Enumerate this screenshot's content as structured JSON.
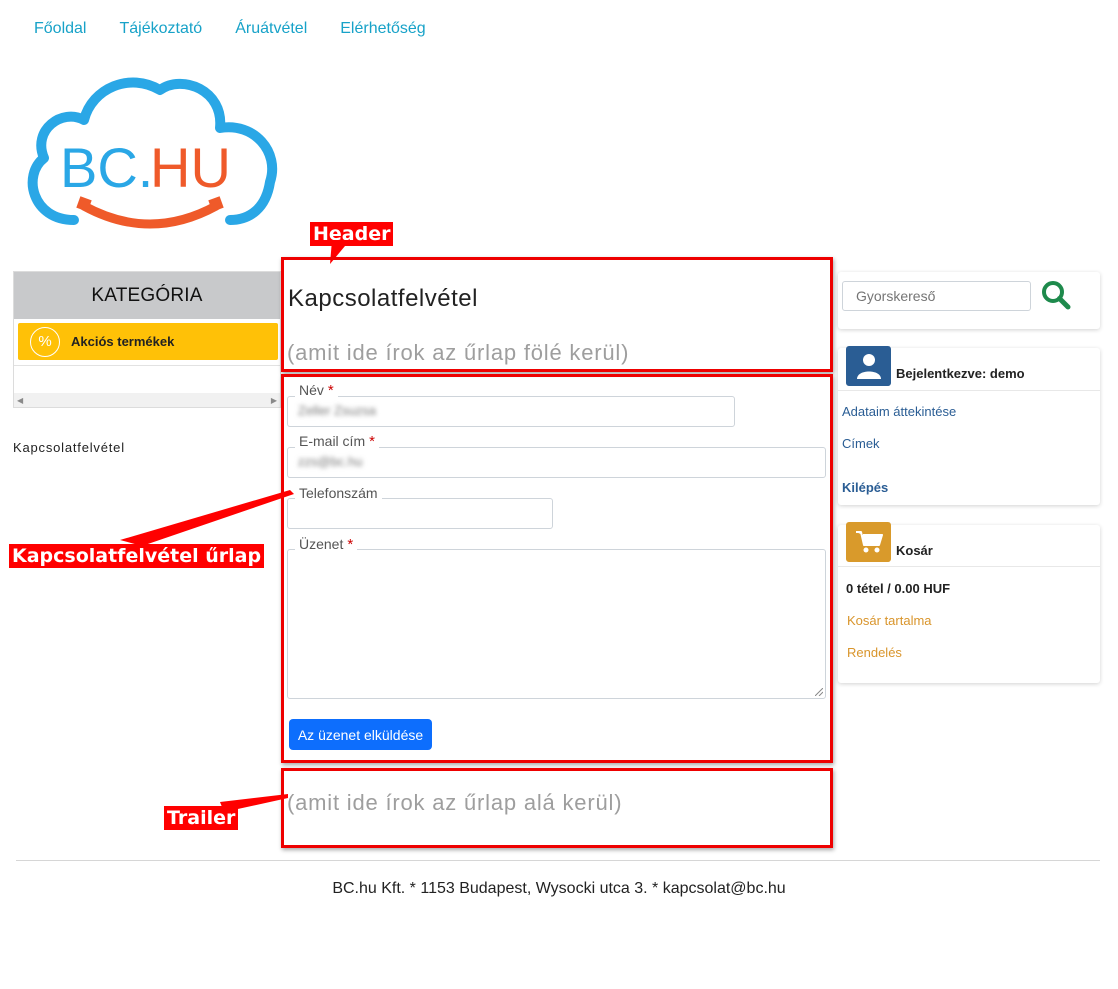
{
  "nav": {
    "items": [
      "Főoldal",
      "Tájékoztató",
      "Áruátvétel",
      "Elérhetőség"
    ]
  },
  "logo": {
    "text": "BC.HU",
    "cloud_color": "#2aa7e6",
    "smile_color": "#ef5a2a"
  },
  "sidebar": {
    "category_title": "KATEGÓRIA",
    "category_item": "Akciós termékek",
    "category_icon": "%",
    "link": "Kapcsolatfelvétel"
  },
  "annotations": {
    "header": "Header",
    "form": "Kapcsolatfelvétel űrlap",
    "trailer": "Trailer"
  },
  "main": {
    "title": "Kapcsolatfelvétel",
    "header_note": "(amit ide írok az űrlap fölé kerül)",
    "trailer_note": "(amit ide írok az űrlap alá kerül)",
    "form": {
      "name_label": "Név",
      "name_value": "Zeller Zsuzsa",
      "email_label": "E-mail cím",
      "email_value": "zzs@bc.hu",
      "phone_label": "Telefonszám",
      "message_label": "Üzenet",
      "required_mark": "*",
      "submit": "Az üzenet elküldése"
    }
  },
  "right": {
    "search_placeholder": "Gyorskereső",
    "user": {
      "title": "Bejelentkezve: demo",
      "links": [
        "Adataim áttekintése",
        "Címek"
      ],
      "logout": "Kilépés"
    },
    "cart": {
      "title": "Kosár",
      "summary": "0 tétel / 0.00 HUF",
      "links": [
        "Kosár tartalma",
        "Rendelés"
      ]
    }
  },
  "footer": {
    "text": "BC.hu Kft. * 1153 Budapest, Wysocki utca 3. * kapcsolat@bc.hu"
  },
  "colors": {
    "link": "#17a2c8",
    "category_bg": "#ffc107",
    "submit_bg": "#0d6efd",
    "annotation": "#ff0000",
    "user_icon_bg": "#2a5d94",
    "cart_icon_bg": "#d99a2b",
    "search_icon": "#1e8a4c"
  }
}
